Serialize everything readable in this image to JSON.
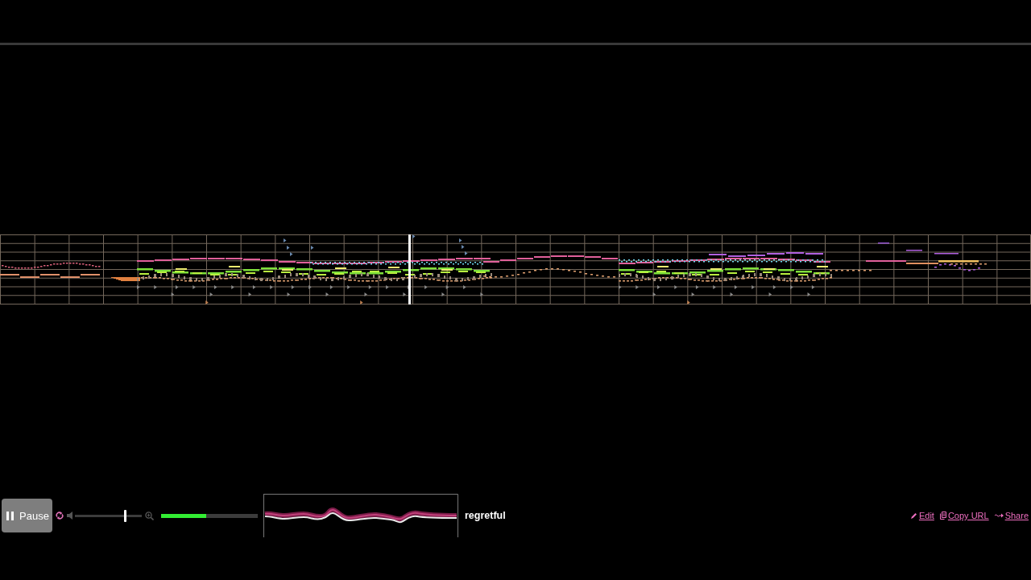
{
  "player": {
    "play_button": {
      "label": "Pause",
      "playing": true
    },
    "loop_button": {
      "on": true
    },
    "volume": {
      "level": 0.75
    },
    "progress": {
      "level": 0.47
    },
    "song_title": "regretful"
  },
  "links": [
    {
      "kind": "edit",
      "label": "Edit"
    },
    {
      "kind": "copy",
      "label": "Copy URL"
    },
    {
      "kind": "share",
      "label": "Share"
    }
  ]
}
